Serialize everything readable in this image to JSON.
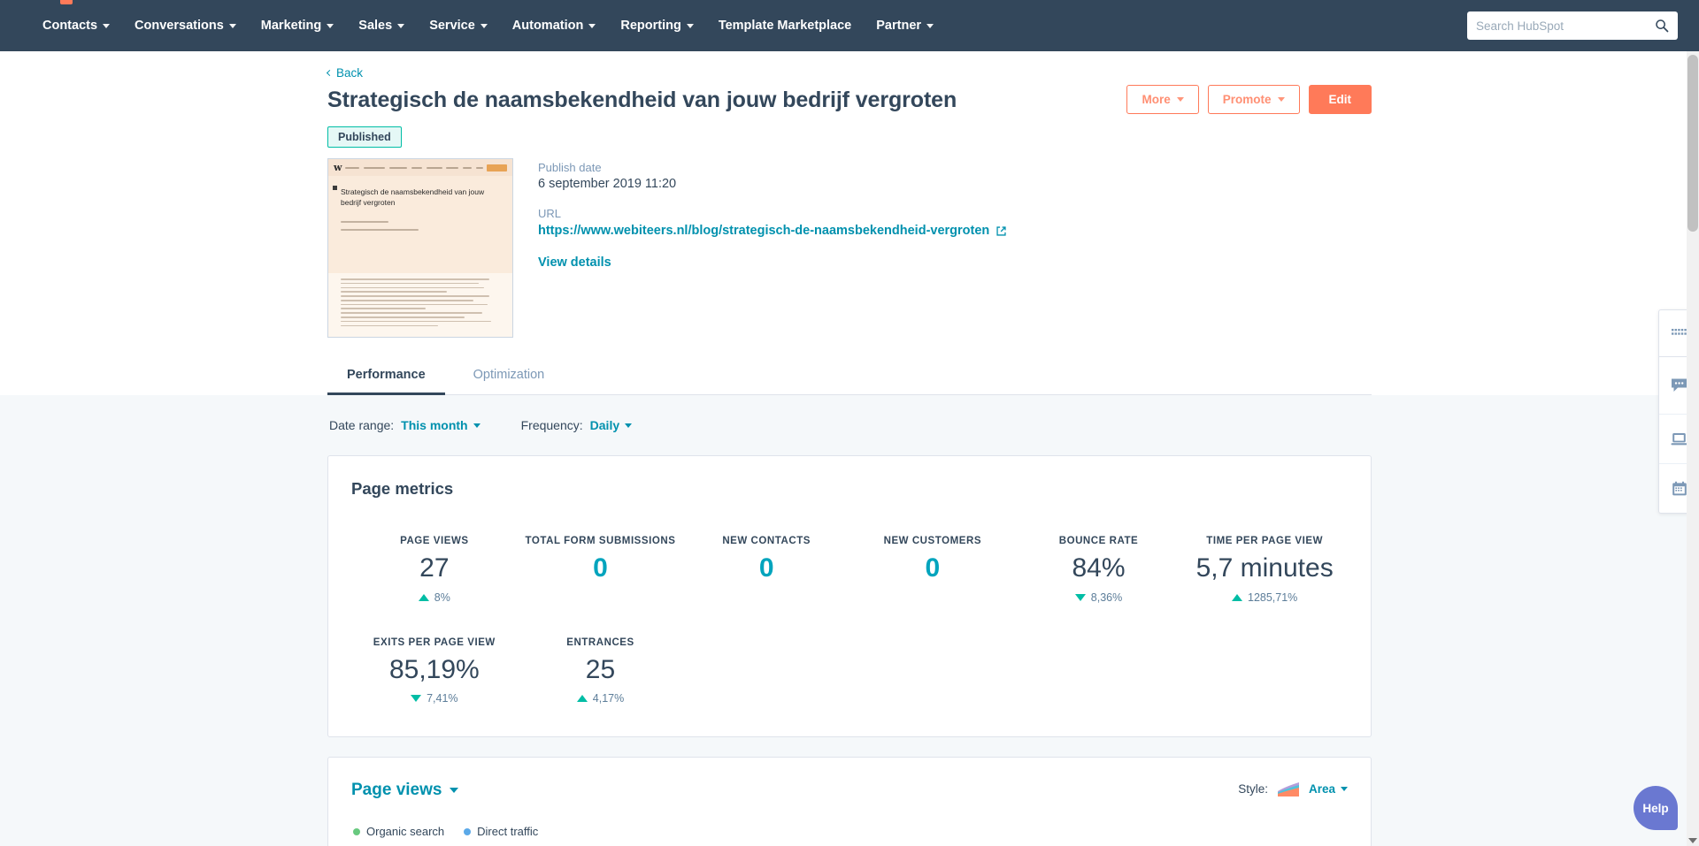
{
  "topnav": {
    "items": [
      {
        "label": "Contacts",
        "caret": true
      },
      {
        "label": "Conversations",
        "caret": true
      },
      {
        "label": "Marketing",
        "caret": true
      },
      {
        "label": "Sales",
        "caret": true
      },
      {
        "label": "Service",
        "caret": true
      },
      {
        "label": "Automation",
        "caret": true
      },
      {
        "label": "Reporting",
        "caret": true
      },
      {
        "label": "Template Marketplace",
        "caret": false
      },
      {
        "label": "Partner",
        "caret": true
      }
    ],
    "search_placeholder": "Search HubSpot",
    "search_value": ""
  },
  "header": {
    "back_label": "Back",
    "title": "Strategisch de naamsbekendheid van jouw bedrijf vergroten",
    "status": "Published",
    "actions": {
      "more": "More",
      "promote": "Promote",
      "edit": "Edit"
    },
    "publish_date_label": "Publish date",
    "publish_date_value": "6 september 2019 11:20",
    "url_label": "URL",
    "url_value": "https://www.webiteers.nl/blog/strategisch-de-naamsbekendheid-vergroten",
    "view_details": "View details",
    "thumbnail_heading": "Strategisch de naamsbekendheid van jouw bedrijf vergroten"
  },
  "tabs": [
    {
      "label": "Performance",
      "active": true
    },
    {
      "label": "Optimization",
      "active": false
    }
  ],
  "filters": {
    "date_range_label": "Date range:",
    "date_range_value": "This month",
    "frequency_label": "Frequency:",
    "frequency_value": "Daily"
  },
  "page_metrics": {
    "title": "Page metrics",
    "row1": [
      {
        "label": "PAGE VIEWS",
        "value": "27",
        "delta": "8%",
        "direction": "up",
        "accent": false
      },
      {
        "label": "TOTAL FORM SUBMISSIONS",
        "value": "0",
        "delta": "",
        "direction": "none",
        "accent": true
      },
      {
        "label": "NEW CONTACTS",
        "value": "0",
        "delta": "",
        "direction": "none",
        "accent": true
      },
      {
        "label": "NEW CUSTOMERS",
        "value": "0",
        "delta": "",
        "direction": "none",
        "accent": true
      },
      {
        "label": "BOUNCE RATE",
        "value": "84%",
        "delta": "8,36%",
        "direction": "down",
        "accent": false
      },
      {
        "label": "TIME PER PAGE VIEW",
        "value": "5,7 minutes",
        "delta": "1285,71%",
        "direction": "up",
        "accent": false
      }
    ],
    "row2": [
      {
        "label": "EXITS PER PAGE VIEW",
        "value": "85,19%",
        "delta": "7,41%",
        "direction": "down",
        "accent": false
      },
      {
        "label": "ENTRANCES",
        "value": "25",
        "delta": "4,17%",
        "direction": "up",
        "accent": false
      }
    ]
  },
  "chart_card": {
    "title": "Page views",
    "style_label": "Style:",
    "style_value": "Area",
    "legend": [
      {
        "label": "Organic search",
        "color": "#68c97f"
      },
      {
        "label": "Direct traffic",
        "color": "#5ba9e8"
      }
    ]
  },
  "rail": {
    "items": [
      {
        "name": "apps-grid-icon"
      },
      {
        "name": "chat-icon"
      },
      {
        "name": "screen-icon"
      },
      {
        "name": "calendar-icon"
      }
    ]
  },
  "help": {
    "label": "Help"
  },
  "colors": {
    "nav_bg": "#33475b",
    "accent_orange": "#ff7a59",
    "link_teal": "#0091ae",
    "value_teal": "#00a4bd",
    "positive_green": "#00bda5",
    "page_bg": "#f5f8fa"
  }
}
